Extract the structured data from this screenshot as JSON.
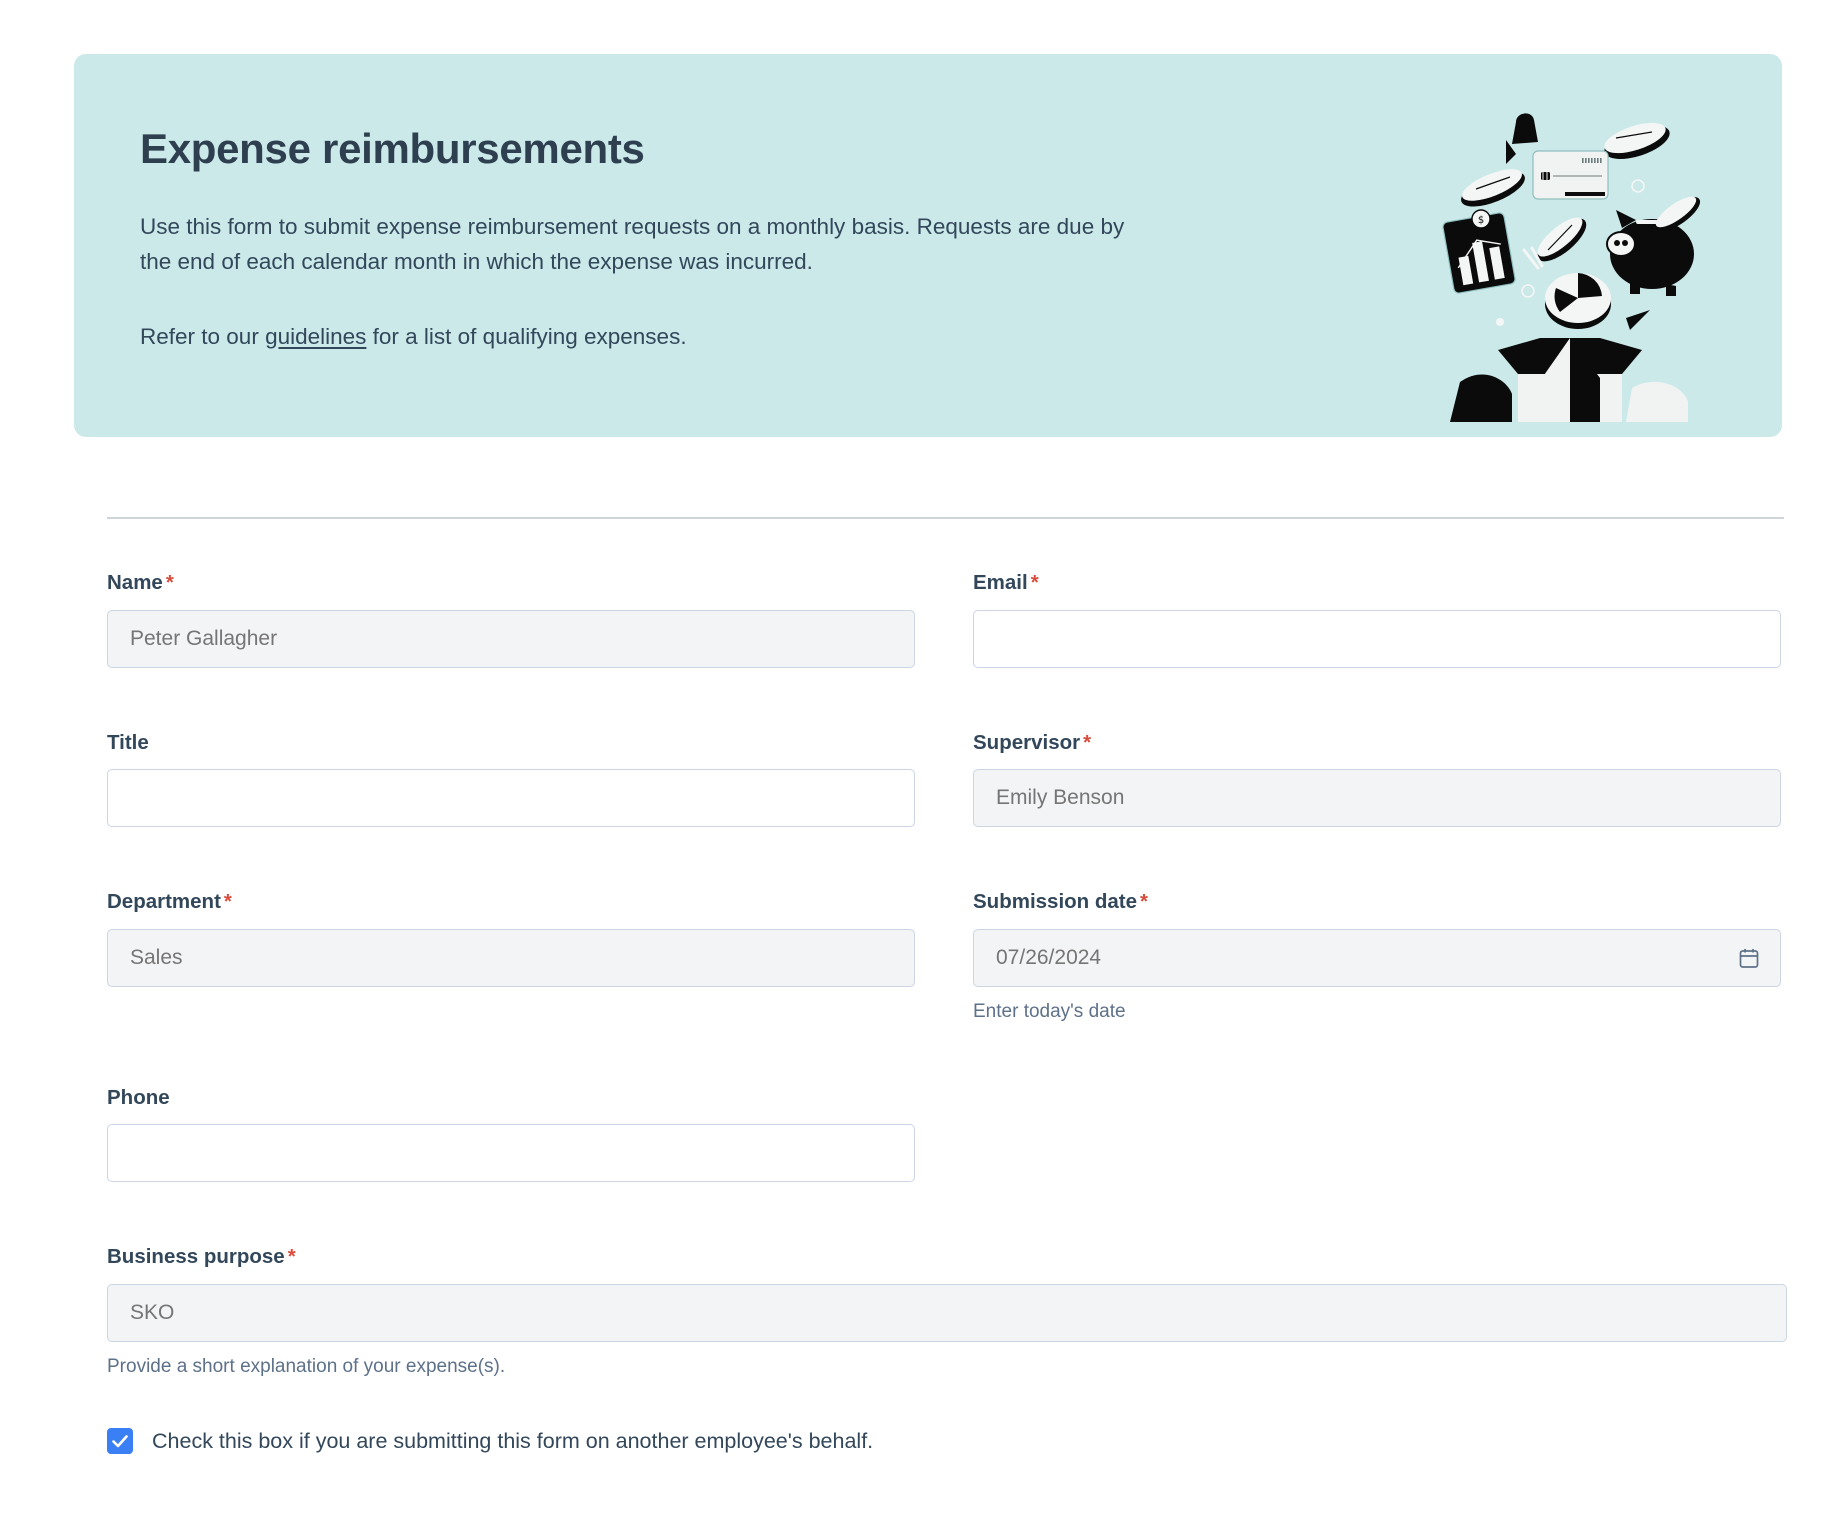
{
  "hero": {
    "title": "Expense reimbursements",
    "paragraph1": "Use this form to submit expense reimbursement requests on a monthly basis. Requests are due by the end of each calendar month in which the expense was incurred.",
    "paragraph2_before": "Refer to our ",
    "paragraph2_link": "guidelines",
    "paragraph2_after": " for a list of qualifying expenses.",
    "background_color": "#cbe9e9",
    "illustration_name": "expenses-illustration"
  },
  "form": {
    "required_marker": "*",
    "fields": {
      "name": {
        "label": "Name",
        "required": true,
        "value": "Peter Gallagher",
        "placeholder": "Peter Gallagher",
        "filled": true
      },
      "email": {
        "label": "Email",
        "required": true,
        "value": "",
        "placeholder": "",
        "filled": false
      },
      "title": {
        "label": "Title",
        "required": false,
        "value": "",
        "placeholder": "",
        "filled": false
      },
      "supervisor": {
        "label": "Supervisor",
        "required": true,
        "value": "Emily Benson",
        "placeholder": "Emily Benson",
        "filled": true
      },
      "department": {
        "label": "Department",
        "required": true,
        "value": "Sales",
        "placeholder": "Sales",
        "filled": true
      },
      "submission_date": {
        "label": "Submission date",
        "required": true,
        "value": "07/26/2024",
        "placeholder": "07/26/2024",
        "helper": "Enter today's date",
        "icon": "calendar-icon",
        "filled": true
      },
      "phone": {
        "label": "Phone",
        "required": false,
        "value": "",
        "placeholder": "",
        "filled": false
      },
      "business_purpose": {
        "label": "Business purpose",
        "required": true,
        "value": "SKO",
        "placeholder": "SKO",
        "helper": "Provide a short explanation of your expense(s).",
        "filled": true
      }
    },
    "checkbox": {
      "label": "Check this box if you are submitting this form on another employee's behalf.",
      "checked": true,
      "color": "#3b7ff5"
    }
  },
  "colors": {
    "text": "#33475b",
    "required": "#d94c3d",
    "border": "#cbd6e2",
    "filled_background": "#f3f4f6",
    "divider": "#cfd4da",
    "accent": "#3b7ff5"
  }
}
